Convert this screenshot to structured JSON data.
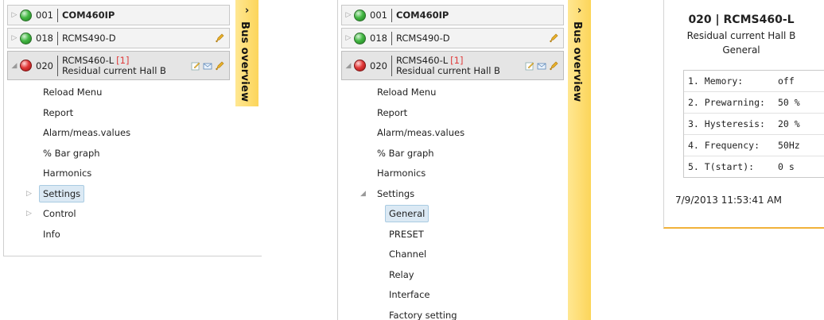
{
  "colors": {
    "bus_bar": "#fcd55a",
    "card_underline": "#f1b23a",
    "alarm_red": "#e03c3c",
    "led_green": "#44b844",
    "led_red": "#e23a3a",
    "selection": "#dbe9f4"
  },
  "bus_overview": {
    "label": "Bus overview",
    "collapse_icon": "chevron-right-icon"
  },
  "devices": [
    {
      "addr": "001",
      "name": "COM460IP",
      "status": "ok"
    },
    {
      "addr": "018",
      "name": "RCMS490-D",
      "status": "ok",
      "icon": "bell-icon"
    },
    {
      "addr": "020",
      "name": "RCMS460-L",
      "alarm_count": "[1]",
      "channel": "Residual current Hall B",
      "status": "alarm",
      "icons": [
        "edit-icon",
        "mail-icon",
        "bell-icon"
      ]
    }
  ],
  "menu_a": {
    "items": [
      "Reload Menu",
      "Report",
      "Alarm/meas.values",
      "% Bar graph",
      "Harmonics",
      "Settings",
      "Control",
      "Info"
    ]
  },
  "menu_b": {
    "items": [
      "Reload Menu",
      "Report",
      "Alarm/meas.values",
      "% Bar graph",
      "Harmonics",
      "Settings"
    ],
    "settings_children": [
      "General",
      "PRESET",
      "Channel",
      "Relay",
      "Interface",
      "Factory setting"
    ]
  },
  "card": {
    "title": "020 | RCMS460-L",
    "channel": "Residual current Hall B",
    "section": "General",
    "rows": [
      {
        "label": "1. Memory:",
        "value": "off"
      },
      {
        "label": "2. Prewarning:",
        "value": "50 %"
      },
      {
        "label": "3. Hysteresis:",
        "value": "20 %"
      },
      {
        "label": "4. Frequency:",
        "value": "50Hz"
      },
      {
        "label": "5. T(start):",
        "value": "0 s"
      }
    ],
    "timestamp": "7/9/2013 11:53:41 AM"
  }
}
